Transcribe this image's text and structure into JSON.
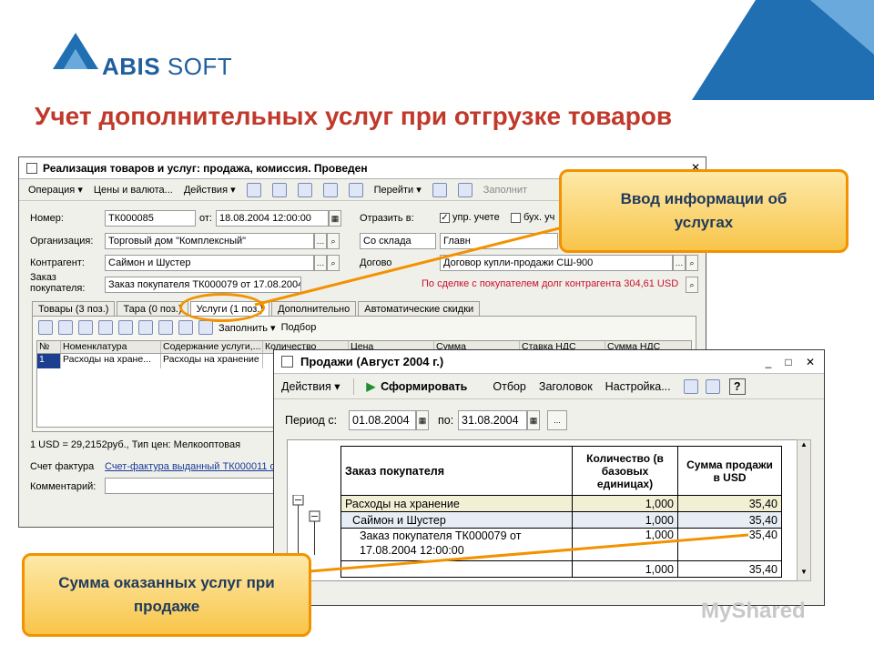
{
  "brand": {
    "name_bold": "ABIS",
    "name_rest": " SOFT",
    "logo_icon": "abis-triangle-logo",
    "accent": "#f39200",
    "title_color": "#c0392b"
  },
  "slide_title": "Учет дополнительных услуг при отгрузке товаров",
  "main_window": {
    "title": "Реализация товаров и услуг: продажа, комиссия. Проведен",
    "menu": [
      "Операция ▾",
      "Цены и валюта...",
      "Действия ▾",
      "Перейти ▾",
      "Заполнит"
    ],
    "fields": {
      "number_label": "Номер:",
      "number_value": "ТК000085",
      "from_label": "от:",
      "date_value": "18.08.2004 12:00:00",
      "reflect_label": "Отразить в:",
      "upr_label": "упр. учете",
      "buh_label": "бух. уч",
      "org_label": "Организация:",
      "org_value": "Торговый дом \"Комплексный\"",
      "warehouse_value": "Со склада",
      "warehouse2_value": "Главн",
      "contractor_label": "Контрагент:",
      "contractor_value": "Саймон и Шустер",
      "contract_label": "Догово",
      "contract_value": "Договор купли-продажи СШ-900",
      "order_label_1": "Заказ",
      "order_label_2": "покупателя:",
      "order_value": "Заказ покупателя ТК000079 от 17.08.2004",
      "debt_text": "По сделке с покупателем долг контрагента 304,61 USD"
    },
    "tabs": [
      "Товары (3 поз.)",
      "Тара (0 поз.)",
      "Услуги (1 поз.)",
      "Дополнительно",
      "Автоматические скидки"
    ],
    "active_tab": 2,
    "tab_toolbar": {
      "fill": "Заполнить ▾",
      "pick": "Подбор"
    },
    "grid_columns": [
      "№",
      "Номенклатура",
      "Содержание услуги,...",
      "Количество",
      "Цена",
      "Сумма",
      "Ставка НДС",
      "Сумма НДС"
    ],
    "grid_rows": [
      [
        "1",
        "Расходы на хране...",
        "Расходы на хранение",
        "",
        "",
        "",
        "",
        ""
      ]
    ],
    "rate_text": "1 USD = 29,2152руб., Тип цен: Мелкооптовая",
    "invoice_label": "Счет фактура",
    "invoice_value": "Счет-фактура выданный ТК000011 о",
    "comment_label": "Комментарий:"
  },
  "report_window": {
    "title": "Продажи (Август 2004 г.)",
    "toolbar": {
      "actions": "Действия ▾",
      "generate": "Сформировать",
      "filter": "Отбор",
      "header": "Заголовок",
      "settings": "Настройка...",
      "help": "?"
    },
    "period_label": "Период с:",
    "date_from": "01.08.2004",
    "to_label": "по:",
    "date_to": "31.08.2004",
    "more": "...",
    "table_headers": [
      "Заказ покупателя",
      "Количество (в базовых единицах)",
      "Сумма продажи в USD"
    ],
    "rows": [
      {
        "name": "Расходы на хранение",
        "qty": "1,000",
        "sum": "35,40",
        "indent": 0,
        "bg": "#f1efd4"
      },
      {
        "name": "Саймон и Шустер",
        "qty": "1,000",
        "sum": "35,40",
        "indent": 1,
        "bg": "#e7edf5"
      },
      {
        "name": "Заказ покупателя ТК000079 от 17.08.2004 12:00:00",
        "qty": "1,000",
        "sum": "35,40",
        "indent": 2,
        "bg": "#ffffff"
      },
      {
        "name": "",
        "qty": "1,000",
        "sum": "35,40",
        "indent": 0,
        "bg": "#ffffff"
      }
    ]
  },
  "callouts": {
    "top": "Ввод информации об услугах",
    "bottom": "Сумма оказанных услуг при продаже"
  },
  "watermark": "MyShared"
}
